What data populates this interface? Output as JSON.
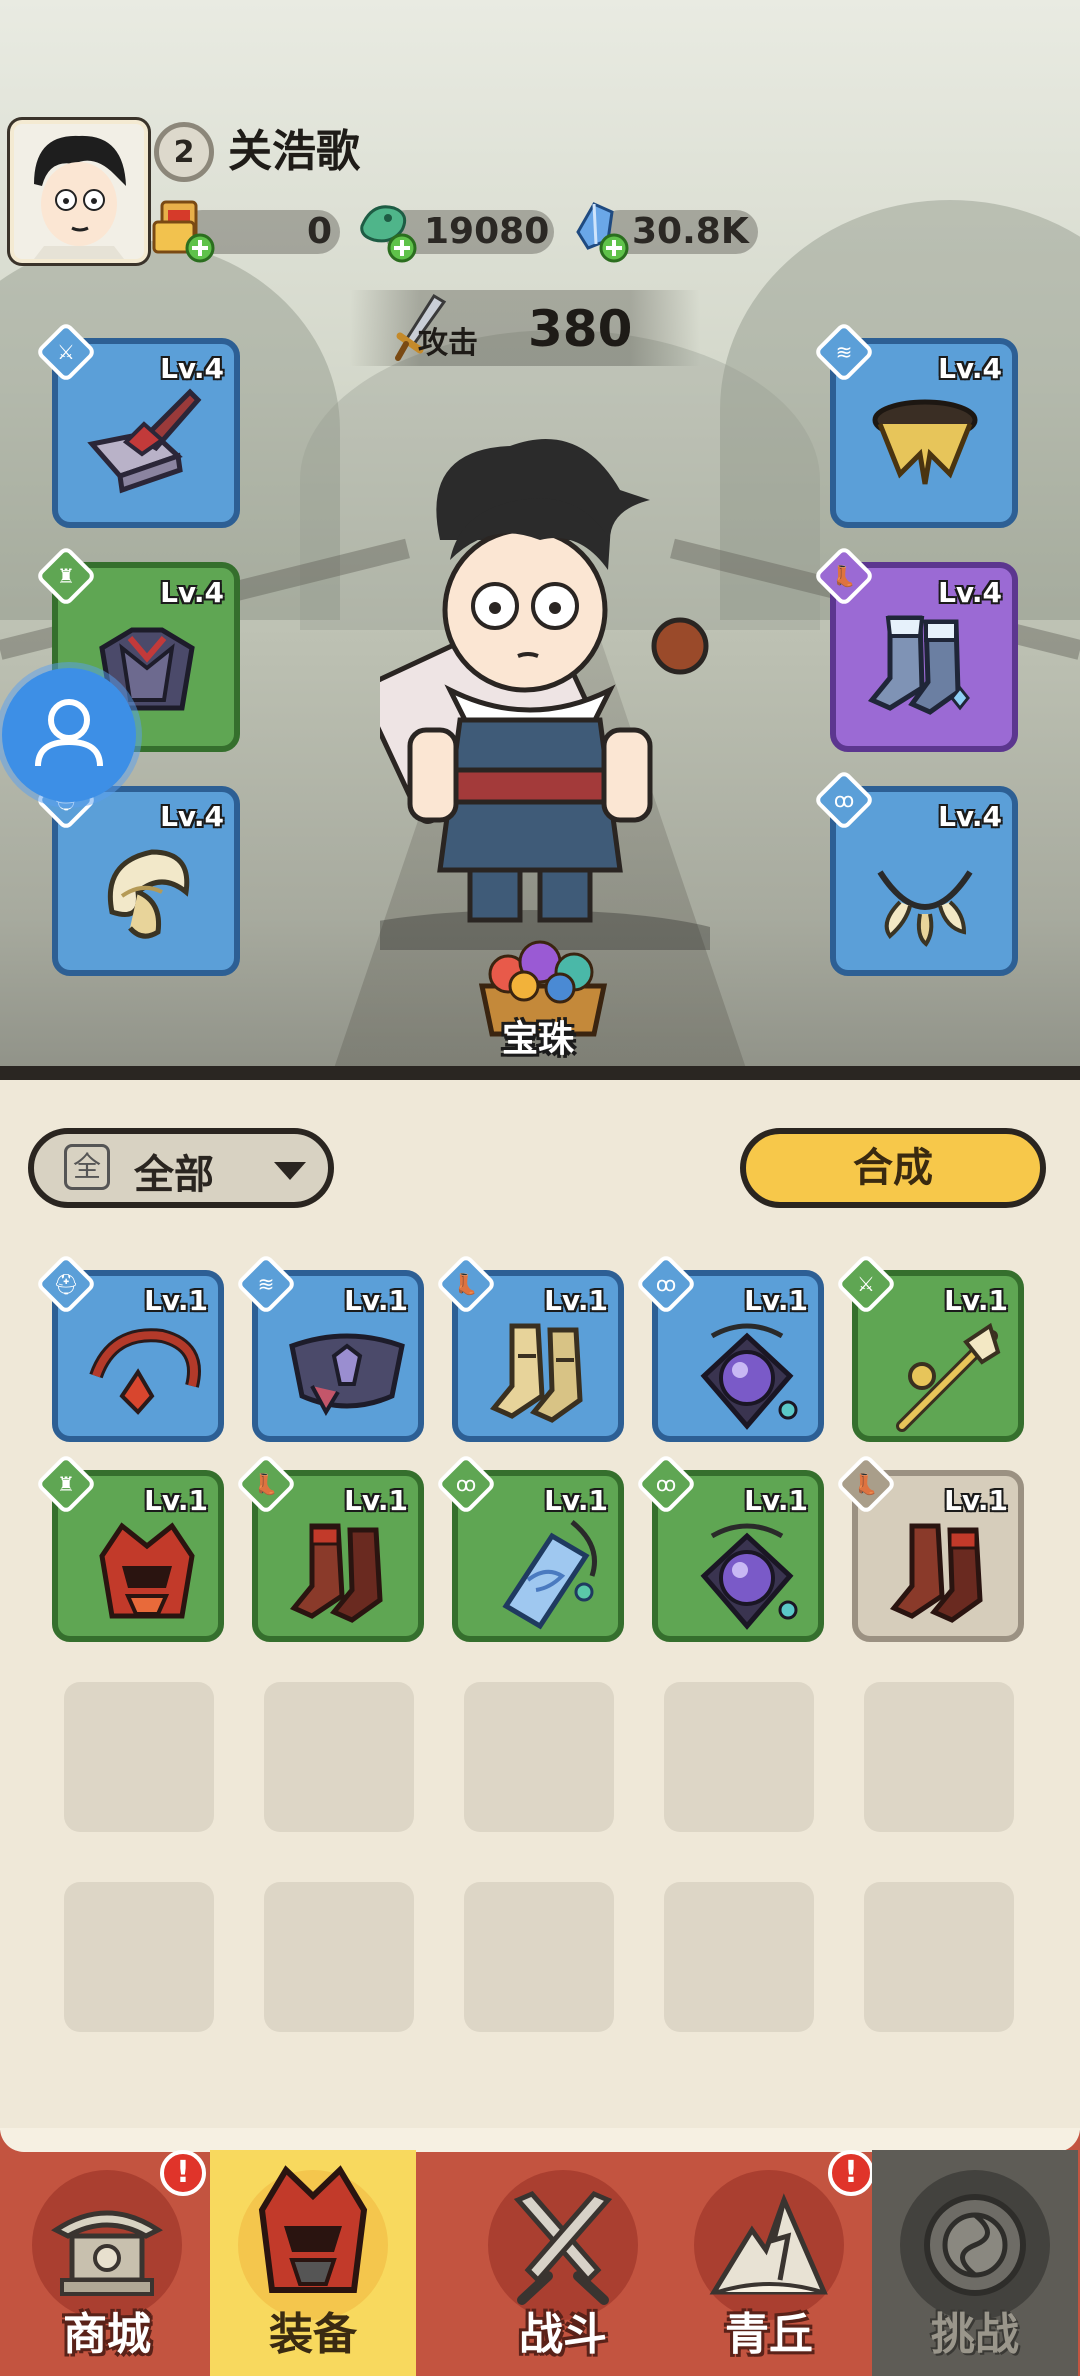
{
  "player": {
    "level": "2",
    "name": "关浩歌"
  },
  "resources": [
    {
      "icon": "scroll-ticket-icon",
      "value": "0"
    },
    {
      "icon": "jade-dragon-coin-icon",
      "value": "19080"
    },
    {
      "icon": "blue-crystal-icon",
      "value": "30.8K"
    }
  ],
  "attack": {
    "label": "攻击",
    "value": "380"
  },
  "equipped": {
    "left": [
      {
        "type": "weapon-icon",
        "level": "Lv.4",
        "color": "blue",
        "item": "hammer-weapon"
      },
      {
        "type": "armor-icon",
        "level": "Lv.4",
        "color": "green",
        "item": "dark-armor"
      },
      {
        "type": "helmet-icon",
        "level": "Lv.4",
        "color": "blue",
        "item": "horn-helmet"
      }
    ],
    "right": [
      {
        "type": "belt-icon",
        "level": "Lv.4",
        "color": "blue",
        "item": "gold-belt"
      },
      {
        "type": "boots-icon",
        "level": "Lv.4",
        "color": "purple",
        "item": "frost-boots"
      },
      {
        "type": "necklace-icon",
        "level": "Lv.4",
        "color": "blue",
        "item": "fang-necklace"
      }
    ]
  },
  "orb": {
    "label": "宝珠"
  },
  "filter": {
    "icon_text": "全",
    "label": "全部"
  },
  "compose_button": "合成",
  "inventory": [
    {
      "type": "helmet-icon",
      "level": "Lv.1",
      "color": "blue"
    },
    {
      "type": "belt-icon",
      "level": "Lv.1",
      "color": "blue"
    },
    {
      "type": "boots-icon",
      "level": "Lv.1",
      "color": "blue"
    },
    {
      "type": "necklace-icon",
      "level": "Lv.1",
      "color": "blue"
    },
    {
      "type": "weapon-icon",
      "level": "Lv.1",
      "color": "green"
    },
    {
      "type": "armor-icon",
      "level": "Lv.1",
      "color": "green"
    },
    {
      "type": "boots-icon",
      "level": "Lv.1",
      "color": "green"
    },
    {
      "type": "necklace-icon",
      "level": "Lv.1",
      "color": "green"
    },
    {
      "type": "necklace-icon",
      "level": "Lv.1",
      "color": "green"
    },
    {
      "type": "boots-icon",
      "level": "Lv.1",
      "color": "grey"
    }
  ],
  "nav": [
    {
      "label": "商城",
      "icon": "shop-icon",
      "alert": true,
      "state": "normal"
    },
    {
      "label": "装备",
      "icon": "equipment-icon",
      "alert": false,
      "state": "active"
    },
    {
      "label": "战斗",
      "icon": "crossed-swords-icon",
      "alert": false,
      "state": "normal"
    },
    {
      "label": "青丘",
      "icon": "mountain-icon",
      "alert": true,
      "state": "normal"
    },
    {
      "label": "挑战",
      "icon": "challenge-orb-icon",
      "alert": false,
      "state": "locked"
    }
  ],
  "colors": {
    "rarity_blue": "#5b9fd8",
    "rarity_green": "#5fa653",
    "rarity_purple": "#9b6ad4",
    "rarity_grey": "#d6cdbb",
    "compose_yellow": "#f7c84a",
    "nav_red": "#c35440"
  }
}
